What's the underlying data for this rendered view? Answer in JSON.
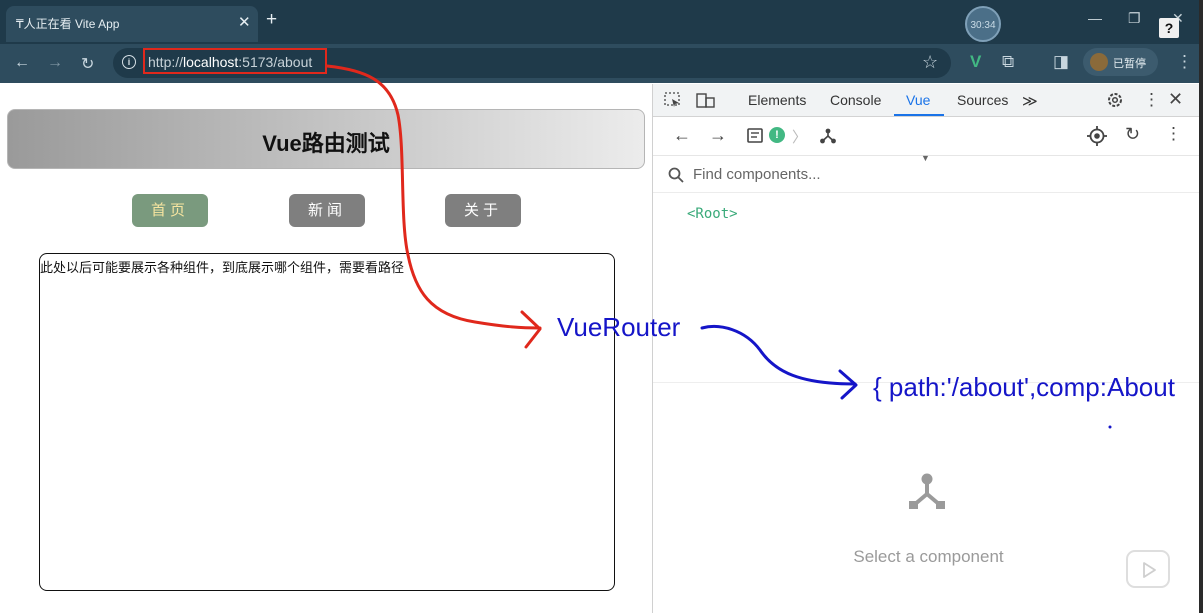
{
  "browser": {
    "tab_title": "₸人正在看 Vite App",
    "tab_close": "✕",
    "new_tab": "+",
    "clock": "30:34",
    "help_badge": "?",
    "window_controls": {
      "minimize": "—",
      "restore": "❐",
      "close": "✕"
    },
    "nav": {
      "back": "←",
      "forward": "→",
      "reload": "↻"
    },
    "url_prefix": "http://",
    "url_host": "localhost",
    "url_rest": ":5173/about",
    "bookmark_star": "☆",
    "extension_v": "V",
    "puzzle_icon": "⧉",
    "sidepanel_icon": "◨",
    "profile_status": "已暂停",
    "menu": "⋮"
  },
  "page": {
    "title": "Vue路由测试",
    "nav_links": [
      "首页",
      "新闻",
      "关于"
    ],
    "content_text": "此处以后可能要展示各种组件，到底展示哪个组件，需要看路径"
  },
  "devtools": {
    "tabs": [
      "Elements",
      "Console",
      "Vue",
      "Sources"
    ],
    "active_tab": "Vue",
    "more_tabs": "≫",
    "find_placeholder": "Find components...",
    "root_node": "<Root>",
    "empty_state": "Select a component"
  },
  "annotations": {
    "vue_router": "VueRouter",
    "route_config": "{ path:'/about',comp:About"
  },
  "colors": {
    "annotation_red": "#e0281c",
    "annotation_blue": "#1515c8",
    "vue_green": "#42b883",
    "active_tab_blue": "#1a73e8"
  }
}
